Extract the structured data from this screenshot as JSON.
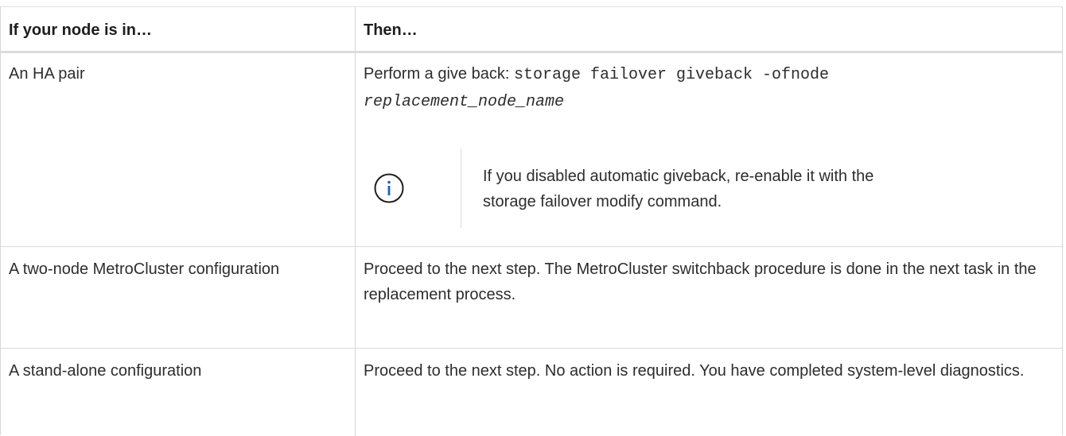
{
  "table": {
    "header": {
      "col1": "If your node is in…",
      "col2": "Then…"
    },
    "rows": [
      {
        "condition": "An HA pair",
        "action_prefix": "Perform a give back: ",
        "action_command": "storage failover giveback -ofnode",
        "action_param": "replacement_node_name",
        "note": {
          "icon": "info-icon",
          "text": "If you disabled automatic giveback, re-enable it with the storage failover modify command."
        }
      },
      {
        "condition": "A two-node MetroCluster configuration",
        "action": "Proceed to the next step. The MetroCluster switchback procedure is done in the next task in the replacement process."
      },
      {
        "condition": "A stand-alone configuration",
        "action": "Proceed to the next step. No action is required. You have completed system-level diagnostics."
      }
    ]
  },
  "colors": {
    "border": "#d6d6d6",
    "text": "#2d2d2d",
    "icon": "#1565c0"
  }
}
